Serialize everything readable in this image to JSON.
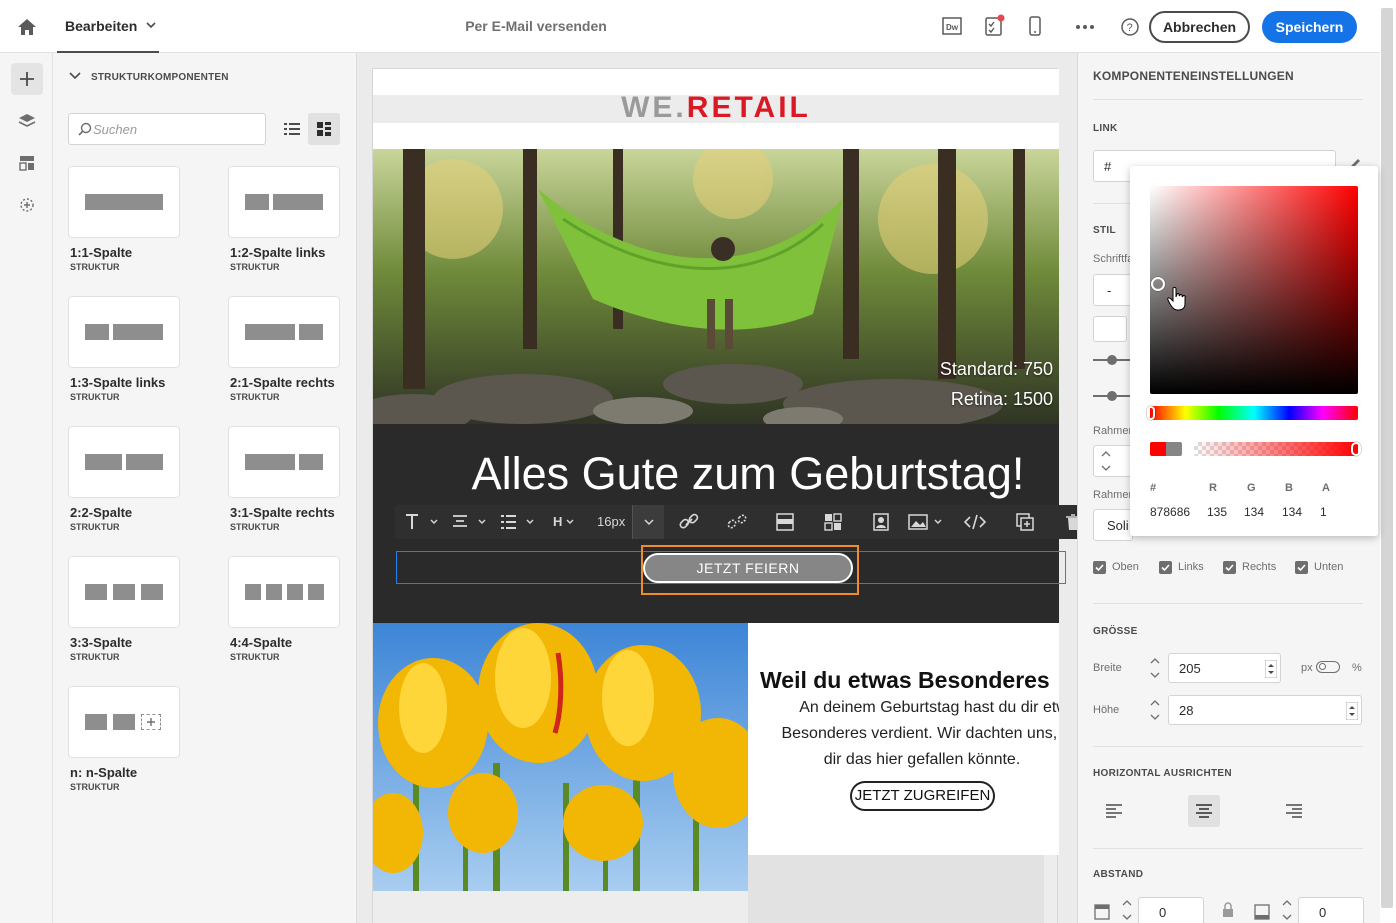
{
  "header": {
    "edit_tab": "Bearbeiten",
    "title": "Per E-Mail versenden",
    "cancel": "Abbrechen",
    "save": "Speichern",
    "icons": [
      "home-icon",
      "dreamweaver-icon",
      "checklist-icon",
      "mobile-preview-icon",
      "more-icon",
      "help-icon"
    ]
  },
  "rail": {
    "icons": [
      "add-icon",
      "layers-icon",
      "fragments-icon",
      "personalization-icon"
    ]
  },
  "components": {
    "section": "STRUKTURKOMPONENTEN",
    "search_placeholder": "Suchen",
    "tiles": [
      {
        "name": "1:1-Spalte",
        "type": "STRUKTUR"
      },
      {
        "name": "1:2-Spalte links",
        "type": "STRUKTUR"
      },
      {
        "name": "1:3-Spalte links",
        "type": "STRUKTUR"
      },
      {
        "name": "2:1-Spalte rechts",
        "type": "STRUKTUR"
      },
      {
        "name": "2:2-Spalte",
        "type": "STRUKTUR"
      },
      {
        "name": "3:1-Spalte rechts",
        "type": "STRUKTUR"
      },
      {
        "name": "3:3-Spalte",
        "type": "STRUKTUR"
      },
      {
        "name": "4:4-Spalte",
        "type": "STRUKTUR"
      },
      {
        "name": "n: n-Spalte",
        "type": "STRUKTUR"
      }
    ]
  },
  "email": {
    "logo_we": "WE.",
    "logo_retail": "RETAIL",
    "hero_standard": "Standard: 750",
    "hero_retina": "Retina: 1500",
    "headline": "Alles Gute zum Geburtstag!",
    "cta": "JETZT FEIERN",
    "section_title": "Weil du etwas Besonderes",
    "body_lines": [
      "An deinem Geburtstag hast du dir etwa",
      "Besonderes verdient. Wir dachten uns, d",
      "dir das hier gefallen könnte."
    ],
    "cta2": "JETZT ZUGREIFEN"
  },
  "toolbar": {
    "font_size": "16px",
    "heading": "H"
  },
  "settings": {
    "title": "KOMPONENTENEINSTELLUNGEN",
    "link_label": "LINK",
    "link_value": "#",
    "style_label": "STIL",
    "font_label": "Schriftfa",
    "font_value": "-",
    "border_label_1": "Rahmen",
    "border_label_2": "Rahmen",
    "border_style": "Soli",
    "checkboxes": [
      "Oben",
      "Links",
      "Rechts",
      "Unten"
    ],
    "size_label": "GRÖSSE",
    "width_label": "Breite",
    "width_value": "205",
    "unit_px": "px",
    "unit_pct": "%",
    "height_label": "Höhe",
    "height_value": "28",
    "align_label": "HORIZONTAL AUSRICHTEN",
    "spacing_label": "ABSTAND",
    "spacing_value_1": "0",
    "spacing_value_2": "0"
  },
  "color_picker": {
    "labels": [
      "#",
      "R",
      "G",
      "B",
      "A"
    ],
    "values": [
      "878686",
      "135",
      "134",
      "134",
      "1"
    ],
    "selected_color": "#878686",
    "hue_color": "#ff0000"
  }
}
